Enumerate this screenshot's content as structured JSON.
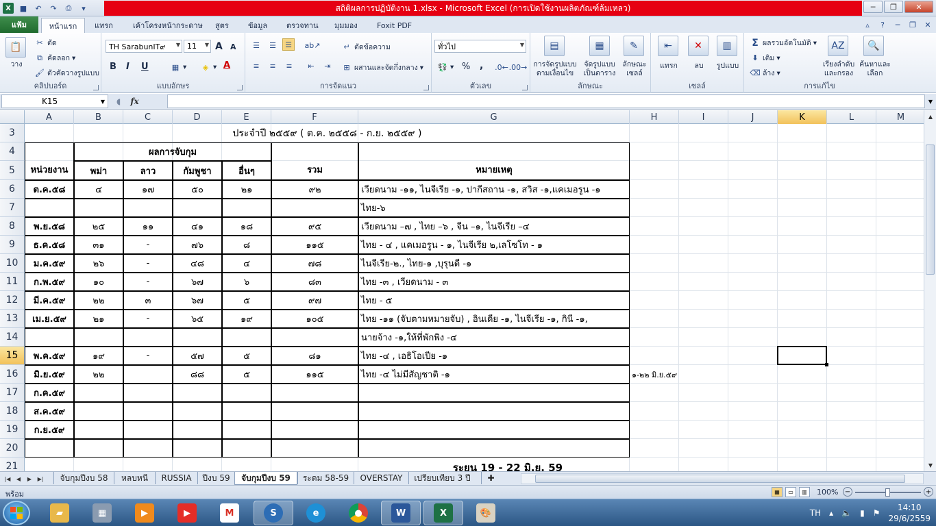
{
  "window": {
    "title": "สถิติผลการปฏิบัติงาน 1.xlsx  -  Microsoft Excel (การเปิดใช้งานผลิตภัณฑ์ล้มเหลว)"
  },
  "tabs": [
    "แฟ้ม",
    "หน้าแรก",
    "แทรก",
    "เค้าโครงหน้ากระดาษ",
    "สูตร",
    "ข้อมูล",
    "ตรวจทาน",
    "มุมมอง",
    "Foxit PDF"
  ],
  "ribbon": {
    "clipboard": {
      "label": "คลิปบอร์ด",
      "paste": "วาง",
      "cut": "ตัด",
      "copy": "คัดลอก",
      "format_painter": "ตัวคัดวางรูปแบบ"
    },
    "font": {
      "label": "แบบอักษร",
      "name": "TH SarabunIT๙",
      "size": "11",
      "bold": "B",
      "italic": "I",
      "underline": "U",
      "grow": "A",
      "shrink": "A",
      "color": "A"
    },
    "alignment": {
      "label": "การจัดแนว",
      "wrap": "ตัดข้อความ",
      "merge": "ผสานและจัดกึ่งกลาง"
    },
    "number": {
      "label": "ตัวเลข",
      "format": "ทั่วไป",
      "percent": "%",
      "comma": ","
    },
    "styles": {
      "label": "ลักษณะ",
      "conditional_1": "การจัดรูปแบบ",
      "conditional_2": "ตามเงื่อนไข",
      "table_1": "จัดรูปแบบ",
      "table_2": "เป็นตาราง",
      "cell_1": "ลักษณะ",
      "cell_2": "เซลล์"
    },
    "cells": {
      "label": "เซลล์",
      "insert": "แทรก",
      "delete": "ลบ",
      "format": "รูปแบบ"
    },
    "editing": {
      "label": "การแก้ไข",
      "autosum": "ผลรวมอัตโนมัติ",
      "fill": "เติม",
      "clear": "ล้าง",
      "sort_1": "เรียงลำดับ",
      "sort_2": "และกรอง",
      "find_1": "ค้นหาและ",
      "find_2": "เลือก"
    }
  },
  "formula_bar": {
    "name_box": "K15",
    "fx": "fx",
    "value": ""
  },
  "columns": [
    "A",
    "B",
    "C",
    "D",
    "E",
    "F",
    "G",
    "H",
    "I",
    "J",
    "K",
    "L",
    "M"
  ],
  "rows": [
    "3",
    "4",
    "5",
    "6",
    "7",
    "8",
    "9",
    "10",
    "11",
    "12",
    "13",
    "14",
    "15",
    "16",
    "17",
    "18",
    "19",
    "20",
    "21"
  ],
  "sheet": {
    "title_row3": "ประจำปี ๒๕๕๙ ( ต.ค. ๒๕๕๘  - ก.ย. ๒๕๕๙ )",
    "header": {
      "unit": "หน่วยงาน",
      "group": "ผลการจับกุม",
      "burma": "พม่า",
      "laos": "ลาว",
      "cambodia": "กัมพูชา",
      "others": "อื่นๆ",
      "total": "รวม",
      "remarks": "หมายเหตุ"
    },
    "data": [
      {
        "unit": "ต.ค.๕๘",
        "b": "๔",
        "c": "๑๗",
        "d": "๕๐",
        "e": "๒๑",
        "f": "๙๒",
        "g": "เวียดนาม -๑๑, ไนจีเรีย -๑, ปากีสถาน -๑, สวิส -๑,แคเมอรูน -๑",
        "h": ""
      },
      {
        "unit": "",
        "b": "",
        "c": "",
        "d": "",
        "e": "",
        "f": "",
        "g": "ไทย-๖",
        "h": ""
      },
      {
        "unit": "พ.ย.๕๘",
        "b": "๒๕",
        "c": "๑๑",
        "d": "๔๑",
        "e": "๑๘",
        "f": "๙๕",
        "g": "เวียดนาม –๗ , ไทย –๖ , จีน –๑, ไนจีเรีย –๔",
        "h": ""
      },
      {
        "unit": "ธ.ค.๕๘",
        "b": "๓๑",
        "c": "-",
        "d": "๗๖",
        "e": "๘",
        "f": "๑๑๕",
        "g": "ไทย - ๔ , แคเมอรูน - ๑, ไนจีเรีย ๒,เลโซโท - ๑",
        "h": ""
      },
      {
        "unit": "ม.ค.๕๙",
        "b": "๒๖",
        "c": "-",
        "d": "๔๘",
        "e": "๔",
        "f": "๗๘",
        "g": "ไนจีเรีย-๒., ไทย-๑ ,บุรุนดี -๑",
        "h": ""
      },
      {
        "unit": "ก.พ.๕๙",
        "b": "๑๐",
        "c": "-",
        "d": "๖๗",
        "e": "๖",
        "f": "๘๓",
        "g": "ไทย -๓ , เวียดนาม - ๓",
        "h": ""
      },
      {
        "unit": "มี.ค.๕๙",
        "b": "๒๒",
        "c": "๓",
        "d": "๖๗",
        "e": "๕",
        "f": "๙๗",
        "g": "ไทย - ๕",
        "h": ""
      },
      {
        "unit": "เม.ย.๕๙",
        "b": "๒๑",
        "c": "-",
        "d": "๖๕",
        "e": "๑๙",
        "f": "๑๐๕",
        "g": "ไทย -๑๑ (จับตามหมายจับ) , อินเดีย -๑, ไนจีเรีย -๑, กินี -๑,",
        "h": ""
      },
      {
        "unit": "",
        "b": "",
        "c": "",
        "d": "",
        "e": "",
        "f": "",
        "g": "นายจ้าง -๑,ให้ที่พักพิง -๔",
        "h": ""
      },
      {
        "unit": "พ.ค.๕๙",
        "b": "๑๙",
        "c": "-",
        "d": "๕๗",
        "e": "๕",
        "f": "๘๑",
        "g": " ไทย -๔ , เอธิโอเปีย -๑",
        "h": ""
      },
      {
        "unit": "มิ.ย.๕๙",
        "b": "๒๒",
        "c": "",
        "d": "๘๘",
        "e": "๕",
        "f": "๑๑๕",
        "g": "ไทย -๔  ไม่มีสัญชาติ -๑",
        "h": "๑-๒๒ มิ.ย.๕๙"
      },
      {
        "unit": "ก.ค.๕๙",
        "b": "",
        "c": "",
        "d": "",
        "e": "",
        "f": "",
        "g": "",
        "h": ""
      },
      {
        "unit": "ส.ค.๕๙",
        "b": "",
        "c": "",
        "d": "",
        "e": "",
        "f": "",
        "g": "",
        "h": ""
      },
      {
        "unit": "ก.ย.๕๙",
        "b": "",
        "c": "",
        "d": "",
        "e": "",
        "f": "",
        "g": "",
        "h": ""
      },
      {
        "unit": "",
        "b": "",
        "c": "",
        "d": "",
        "e": "",
        "f": "",
        "g": "",
        "h": ""
      }
    ],
    "row21_partial": "ระยน 19 - 22 มิ.ย. 59"
  },
  "sheet_tabs": [
    "จับกุมปีงบ 58",
    "หลบหนี",
    "RUSSIA",
    "ปีงบ 59",
    "จับกุมปีงบ 59",
    "ระดม 58-59",
    "OVERSTAY",
    "เปรียบเทียบ 3 ปี"
  ],
  "active_sheet": "จับกุมปีงบ 59",
  "status": {
    "mode": "พร้อม",
    "zoom": "100%"
  },
  "taskbar": {
    "language": "TH",
    "time": "14:10",
    "date": "29/6/2559"
  },
  "colors": {
    "title_red": "#e60012",
    "excel_green": "#1e7145",
    "selection": "#f2c25b"
  }
}
